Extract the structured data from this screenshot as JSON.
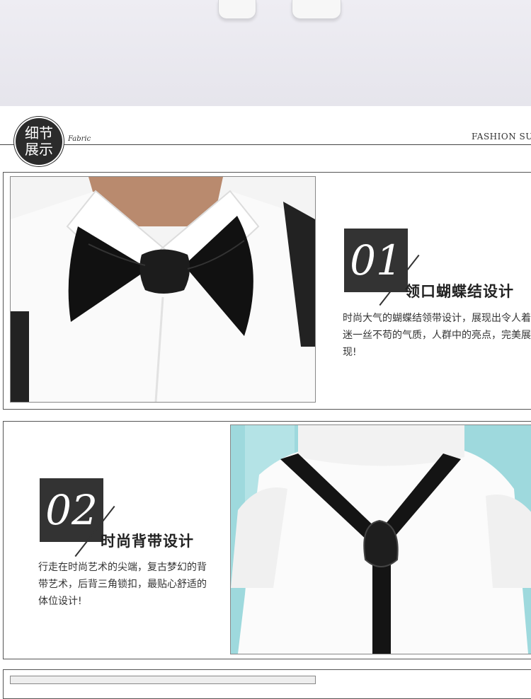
{
  "header": {
    "badge_line1": "细节",
    "badge_line2": "展示",
    "fabric_label": "Fabric",
    "fashion_label": "FASHION SU"
  },
  "features": [
    {
      "number": "01",
      "title": "领口蝴蝶结设计",
      "description": "时尚大气的蝴蝶结领带设计，展现出令人着迷一丝不苟的气质，人群中的亮点，完美展现!"
    },
    {
      "number": "02",
      "title": "时尚背带设计",
      "description": "行走在时尚艺术的尖端，复古梦幻的背带艺术，后背三角锁扣，最贴心舒适的体位设计!"
    }
  ],
  "colors": {
    "accent_dark": "#333333",
    "wall_teal": "#9ed9dd",
    "floor_gray": "#eeedf3"
  }
}
